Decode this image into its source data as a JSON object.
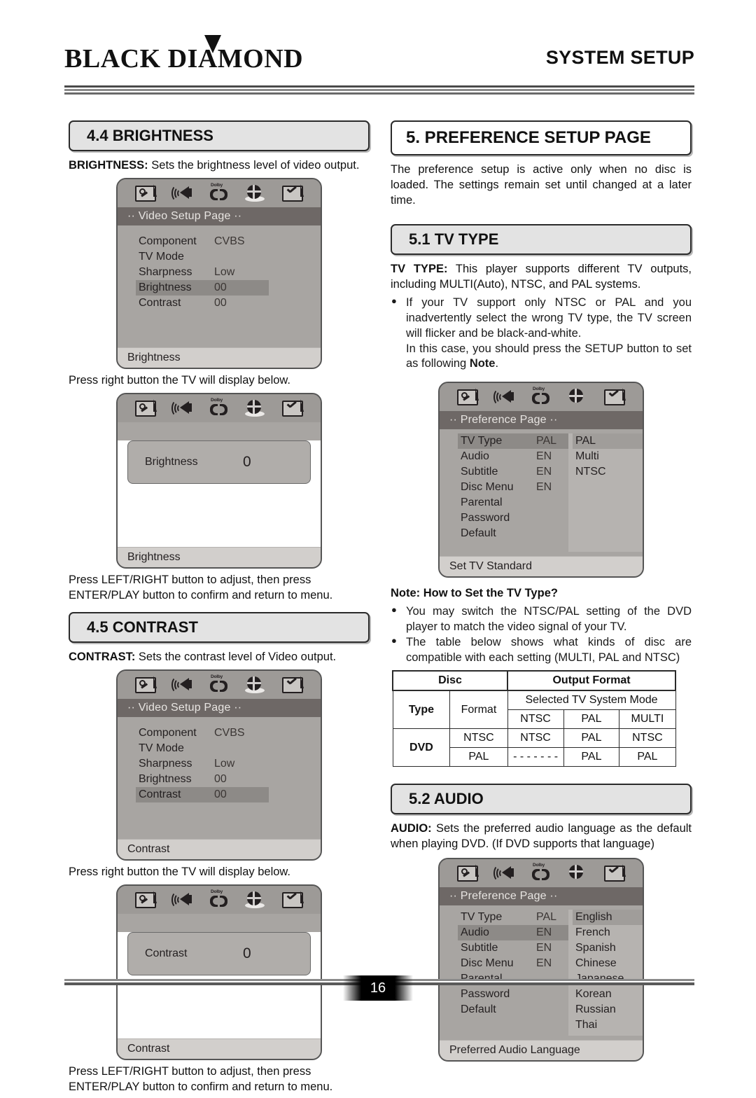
{
  "header": {
    "logo": "BLACK DIAMOND",
    "title": "SYSTEM SETUP"
  },
  "footer": {
    "page_number": "16"
  },
  "osd_icons": [
    "general-setup-icon",
    "audio-setup-icon",
    "dolby-digital-icon",
    "video-setup-icon",
    "preference-setup-icon"
  ],
  "left": {
    "brightness": {
      "heading": "4.4 BRIGHTNESS",
      "intro": "BRIGHTNESS:",
      "intro_rest": " Sets the brightness level of video output.",
      "screen1": {
        "title": "·· Video Setup Page ··",
        "rows": [
          {
            "label": "Component",
            "value": "CVBS",
            "highlighted": false
          },
          {
            "label": "TV Mode",
            "value": "",
            "highlighted": false
          },
          {
            "label": "Sharpness",
            "value": "Low",
            "highlighted": false
          },
          {
            "label": "Brightness",
            "value": "00",
            "highlighted": true
          },
          {
            "label": "Contrast",
            "value": "00",
            "highlighted": false
          }
        ],
        "status": "Brightness"
      },
      "mid_text": "Press right button the TV will display below.",
      "screen2": {
        "value_label": "Brightness",
        "value": "0",
        "status": "Brightness"
      },
      "outro": "Press LEFT/RIGHT button to adjust, then press ENTER/PLAY button to confirm and return to menu."
    },
    "contrast": {
      "heading": "4.5 CONTRAST",
      "intro": "CONTRAST:",
      "intro_rest": " Sets the contrast level of Video output.",
      "screen1": {
        "title": "·· Video Setup Page ··",
        "rows": [
          {
            "label": "Component",
            "value": "CVBS",
            "highlighted": false
          },
          {
            "label": "TV Mode",
            "value": "",
            "highlighted": false
          },
          {
            "label": "Sharpness",
            "value": "Low",
            "highlighted": false
          },
          {
            "label": "Brightness",
            "value": "00",
            "highlighted": false
          },
          {
            "label": "Contrast",
            "value": "00",
            "highlighted": true
          }
        ],
        "status": "Contrast"
      },
      "mid_text": "Press right button the TV will display below.",
      "screen2": {
        "value_label": "Contrast",
        "value": "0",
        "status": "Contrast"
      },
      "outro": "Press LEFT/RIGHT button to adjust, then press ENTER/PLAY button to confirm and return to menu."
    }
  },
  "right": {
    "preference": {
      "heading": "5. PREFERENCE SETUP PAGE",
      "intro": "The preference setup is active only when no disc is loaded. The settings remain set until changed at a later time."
    },
    "tvtype": {
      "heading": "5.1 TV TYPE",
      "intro_bold": "TV TYPE:",
      "intro_rest": "  This player supports different TV outputs, including MULTI(Auto), NTSC, and PAL systems.",
      "bullet1": "If your TV support only NTSC or PAL and you inadvertently select the wrong TV type, the TV screen will flicker and be black-and-white.",
      "bullet1_cont_a": "In this case, you should press the SETUP button to set as following ",
      "bullet1_cont_b": "Note",
      "bullet1_cont_c": ".",
      "screen": {
        "title": "·· Preference Page ··",
        "rows": [
          {
            "label": "TV Type",
            "value": "PAL",
            "highlighted": true
          },
          {
            "label": "Audio",
            "value": "EN",
            "highlighted": false
          },
          {
            "label": "Subtitle",
            "value": "EN",
            "highlighted": false
          },
          {
            "label": "Disc Menu",
            "value": "EN",
            "highlighted": false
          },
          {
            "label": "Parental",
            "value": "",
            "highlighted": false
          },
          {
            "label": "Password",
            "value": "",
            "highlighted": false
          },
          {
            "label": "Default",
            "value": "",
            "highlighted": false
          }
        ],
        "submenu": [
          {
            "label": "PAL",
            "highlighted": true
          },
          {
            "label": "Multi",
            "highlighted": false
          },
          {
            "label": "NTSC",
            "highlighted": false
          }
        ],
        "status": "Set TV Standard"
      }
    },
    "note": {
      "title": "Note: How to Set the TV Type?",
      "bullet1": "You may switch the NTSC/PAL setting of the DVD player to match the video signal of your TV.",
      "bullet2": "The table below shows what kinds of disc are compatible with each setting (MULTI, PAL and NTSC)"
    },
    "table": {
      "disc_header": "Disc",
      "output_header": "Output Format",
      "type_header": "Type",
      "format_header": "Format",
      "selected_mode_header": "Selected TV System Mode",
      "mode_cols": [
        "NTSC",
        "PAL",
        "MULTI"
      ],
      "disc_type": "DVD",
      "rows": [
        {
          "format": "NTSC",
          "values": [
            "NTSC",
            "PAL",
            "NTSC"
          ]
        },
        {
          "format": "PAL",
          "values": [
            "- - - - - - -",
            "PAL",
            "PAL"
          ]
        }
      ]
    },
    "audio": {
      "heading": "5.2 AUDIO",
      "intro_bold": "AUDIO:",
      "intro_rest": " Sets the preferred audio language as the default when playing DVD. (If DVD supports that language)",
      "screen": {
        "title": "·· Preference Page ··",
        "rows": [
          {
            "label": "TV Type",
            "value": "PAL",
            "highlighted": false
          },
          {
            "label": "Audio",
            "value": "EN",
            "highlighted": true
          },
          {
            "label": "Subtitle",
            "value": "EN",
            "highlighted": false
          },
          {
            "label": "Disc Menu",
            "value": "EN",
            "highlighted": false
          },
          {
            "label": "Parental",
            "value": "",
            "highlighted": false
          },
          {
            "label": "Password",
            "value": "",
            "highlighted": false
          },
          {
            "label": "Default",
            "value": "",
            "highlighted": false
          }
        ],
        "submenu": [
          {
            "label": "English",
            "highlighted": true
          },
          {
            "label": "French",
            "highlighted": false
          },
          {
            "label": "Spanish",
            "highlighted": false
          },
          {
            "label": "Chinese",
            "highlighted": false
          },
          {
            "label": "Japanese",
            "highlighted": false
          },
          {
            "label": "Korean",
            "highlighted": false
          },
          {
            "label": "Russian",
            "highlighted": false
          },
          {
            "label": "Thai",
            "highlighted": false
          }
        ],
        "status": "Preferred Audio Language"
      }
    }
  }
}
